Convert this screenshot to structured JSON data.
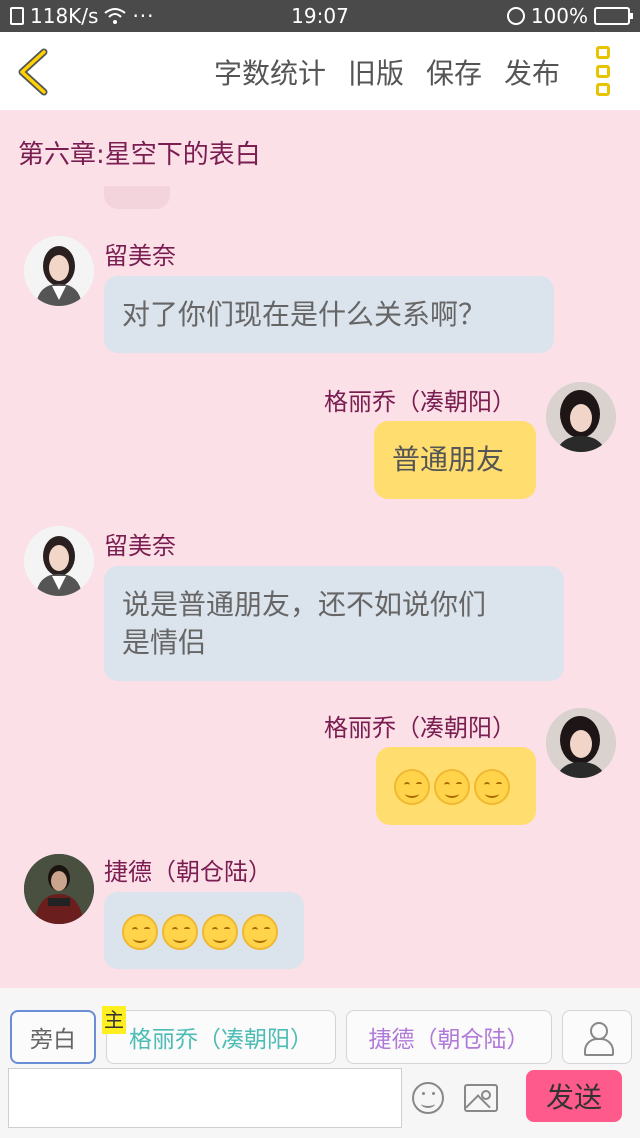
{
  "status_bar": {
    "network_speed": "118K/s",
    "more": "···",
    "time": "19:07",
    "battery": "100%"
  },
  "header": {
    "actions": [
      "字数统计",
      "旧版",
      "保存",
      "发布"
    ]
  },
  "chapter": {
    "title": "第六章:星空下的表白"
  },
  "messages": [
    {
      "side": "left",
      "speaker": "留美奈",
      "text": "对了你们现在是什么关系啊？"
    },
    {
      "side": "right",
      "speaker": "格丽乔（凑朝阳）",
      "text": "普通朋友"
    },
    {
      "side": "left",
      "speaker": "留美奈",
      "text_line1": "说是普通朋友，还不如说你们",
      "text_line2": "是情侣"
    },
    {
      "side": "right",
      "speaker": "格丽乔（凑朝阳）",
      "emoji": "smile-emoji",
      "emoji_count": 3
    },
    {
      "side": "left",
      "speaker": "捷德（朝仓陆）",
      "emoji": "smile-emoji",
      "emoji_count": 4
    }
  ],
  "bottom_bar": {
    "roles": {
      "narration": "旁白",
      "main_tag": "主",
      "role1": "格丽乔（凑朝阳）",
      "role2": "捷德（朝仓陆）"
    },
    "input_placeholder": "",
    "send_label": "发送"
  },
  "colors": {
    "background": "#fbe0e8",
    "accent_yellow": "#ffdd6e",
    "send_pink": "#ff5a8c",
    "title_color": "#7a1d50"
  }
}
